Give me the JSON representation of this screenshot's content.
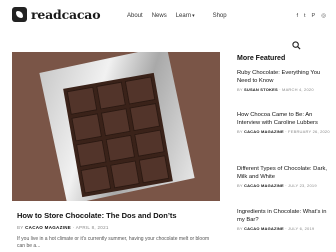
{
  "brand": {
    "name": "readcacao"
  },
  "nav": {
    "items": [
      "About",
      "News",
      "Learn",
      "Shop"
    ],
    "learn_chevron": "▾"
  },
  "social": {
    "icons": [
      "facebook-icon",
      "twitter-icon",
      "pinterest-icon",
      "instagram-icon"
    ],
    "glyphs": [
      "f",
      "t",
      "P",
      "◎"
    ]
  },
  "hero": {
    "title": "How to Store Chocolate: The Dos and Don’ts",
    "byline": "BY",
    "author": "CACAO MAGAZINE",
    "date": "· APRIL 8, 2021",
    "excerpt": "If you live in a hot climate or it's currently summer, having your chocolate melt or bloom can be a..."
  },
  "sidebar": {
    "heading": "More Featured",
    "items": [
      {
        "title": "Ruby Chocolate: Everything You Need to Know",
        "byline": "BY",
        "author": "SUSAN STOKES",
        "date": "· MARCH 4, 2020"
      },
      {
        "title": "How Chocoa Came to Be: An Interview with Caroline Lubbers",
        "byline": "BY",
        "author": "CACAO MAGAZINE",
        "date": "· FEBRUARY 26, 2020"
      },
      {
        "title": "Different Types of Chocolate: Dark, Milk and White",
        "byline": "BY",
        "author": "CACAO MAGAZINE",
        "date": "· JULY 23, 2019"
      },
      {
        "title": "Ingredients in Chocolate: What’s in my Bar?",
        "byline": "BY",
        "author": "CACAO MAGAZINE",
        "date": "· JULY 6, 2019"
      }
    ]
  }
}
